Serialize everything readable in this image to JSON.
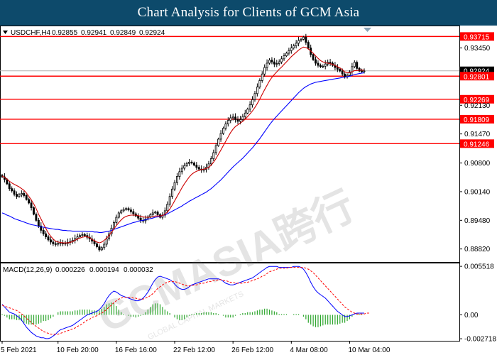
{
  "header": {
    "title": "Chart Analysis for Clients of GCM Asia"
  },
  "chart_data": {
    "type": "candlestick",
    "symbol_line": {
      "symbol": "USDCHF,H4",
      "ohlc": [
        "0.92855",
        "0.92941",
        "0.92849",
        "0.92924"
      ]
    },
    "watermark": {
      "text": "GCMASIA跨行",
      "subtext": "GLOBAL CAPITAL MARKETS"
    },
    "price_axis": {
      "range": [
        0.8852,
        0.9395
      ],
      "ticks": [
        "0.93450",
        "0.92130",
        "0.91470",
        "0.90800",
        "0.90140",
        "0.89480",
        "0.88820"
      ]
    },
    "current_price": {
      "label": "0.92924",
      "value": 0.92924,
      "color": "#000000"
    },
    "levels": [
      {
        "label": "0.93715",
        "value": 0.93715,
        "color": "#ff0000"
      },
      {
        "label": "0.92801",
        "value": 0.92801,
        "color": "#ff0000"
      },
      {
        "label": "0.92269",
        "value": 0.92269,
        "color": "#ff0000"
      },
      {
        "label": "0.91809",
        "value": 0.91809,
        "color": "#ff0000"
      },
      {
        "label": "0.91246",
        "value": 0.91246,
        "color": "#ff0000"
      }
    ],
    "x_labels": [
      "5 Feb 2021",
      "10 Feb 20:00",
      "16 Feb 16:00",
      "22 Feb 12:00",
      "26 Feb 12:00",
      "4 Mar 08:00",
      "10 Mar 04:00"
    ],
    "x_label_index": [
      0,
      23,
      47,
      71,
      95,
      119,
      143
    ],
    "close": [
      0.9048,
      0.9042,
      0.9032,
      0.9021,
      0.9016,
      0.9008,
      0.9003,
      0.9007,
      0.901,
      0.9005,
      0.8996,
      0.8988,
      0.8977,
      0.8962,
      0.8948,
      0.8935,
      0.8925,
      0.8917,
      0.891,
      0.8903,
      0.8898,
      0.8894,
      0.8893,
      0.8895,
      0.8896,
      0.8894,
      0.8895,
      0.8897,
      0.8899,
      0.8902,
      0.8906,
      0.891,
      0.8913,
      0.8915,
      0.8913,
      0.8909,
      0.8905,
      0.89,
      0.8894,
      0.8887,
      0.888,
      0.8885,
      0.8893,
      0.8905,
      0.8917,
      0.893,
      0.8943,
      0.8955,
      0.8965,
      0.897,
      0.8973,
      0.8975,
      0.8972,
      0.8968,
      0.8963,
      0.8958,
      0.8953,
      0.8948,
      0.8947,
      0.8951,
      0.8956,
      0.8961,
      0.8965,
      0.8967,
      0.8961,
      0.8955,
      0.896,
      0.897,
      0.8985,
      0.9003,
      0.902,
      0.9035,
      0.9049,
      0.906,
      0.9068,
      0.9074,
      0.9079,
      0.9082,
      0.908,
      0.9075,
      0.907,
      0.9066,
      0.9064,
      0.9065,
      0.907,
      0.9078,
      0.909,
      0.9104,
      0.912,
      0.9135,
      0.9148,
      0.916,
      0.917,
      0.9178,
      0.9184,
      0.9186,
      0.918,
      0.9176,
      0.918,
      0.9187,
      0.9195,
      0.9204,
      0.9214,
      0.9226,
      0.924,
      0.9255,
      0.927,
      0.9285,
      0.93,
      0.931,
      0.9317,
      0.9313,
      0.9308,
      0.9309,
      0.9313,
      0.932,
      0.9327,
      0.9333,
      0.9339,
      0.9345,
      0.935,
      0.9356,
      0.9362,
      0.9365,
      0.937,
      0.9358,
      0.9345,
      0.933,
      0.9318,
      0.931,
      0.9305,
      0.9302,
      0.9303,
      0.9308,
      0.9312,
      0.931,
      0.9305,
      0.93,
      0.9296,
      0.9292,
      0.9285,
      0.9278,
      0.9282,
      0.929,
      0.9302,
      0.9312,
      0.9298,
      0.9292,
      0.9291,
      0.9292
    ],
    "sma_short": [
      0.905,
      0.9047,
      0.9043,
      0.9038,
      0.9034,
      0.9031,
      0.9028,
      0.9025,
      0.9021,
      0.9017,
      0.9011,
      0.9003,
      0.8995,
      0.8986,
      0.8975,
      0.8962,
      0.8951,
      0.894,
      0.8929,
      0.8919,
      0.8911,
      0.8905,
      0.89,
      0.8898,
      0.8897,
      0.8896,
      0.8896,
      0.8896,
      0.8897,
      0.8899,
      0.8902,
      0.8905,
      0.8907,
      0.8909,
      0.891,
      0.891,
      0.8908,
      0.8904,
      0.8901,
      0.8898,
      0.8896,
      0.8898,
      0.8902,
      0.8907,
      0.8913,
      0.892,
      0.8928,
      0.8936,
      0.8943,
      0.8949,
      0.8954,
      0.8957,
      0.8959,
      0.896,
      0.896,
      0.896,
      0.8959,
      0.8957,
      0.8956,
      0.8955,
      0.8955,
      0.8955,
      0.8956,
      0.8958,
      0.8958,
      0.8958,
      0.8959,
      0.8962,
      0.8967,
      0.8974,
      0.8983,
      0.8993,
      0.9003,
      0.9013,
      0.9023,
      0.9032,
      0.904,
      0.9048,
      0.9054,
      0.9058,
      0.9061,
      0.9063,
      0.9065,
      0.9066,
      0.9067,
      0.907,
      0.9075,
      0.9082,
      0.909,
      0.91,
      0.911,
      0.912,
      0.913,
      0.914,
      0.915,
      0.9158,
      0.9164,
      0.9168,
      0.9172,
      0.9176,
      0.9181,
      0.9187,
      0.9193,
      0.92,
      0.9208,
      0.9217,
      0.9227,
      0.9238,
      0.9249,
      0.9259,
      0.9269,
      0.9277,
      0.9284,
      0.929,
      0.9296,
      0.9301,
      0.9307,
      0.9313,
      0.9319,
      0.9325,
      0.933,
      0.9335,
      0.934,
      0.9344,
      0.9347,
      0.9346,
      0.9343,
      0.9338,
      0.9333,
      0.9327,
      0.9321,
      0.9316,
      0.9313,
      0.9311,
      0.931,
      0.9309,
      0.9307,
      0.9305,
      0.9302,
      0.9299,
      0.9295,
      0.929,
      0.9288,
      0.9288,
      0.929,
      0.9293,
      0.9293,
      0.9294,
      0.9294,
      0.9294
    ],
    "sma_long": [
      0.8965,
      0.8963,
      0.896,
      0.8958,
      0.8955,
      0.8952,
      0.895,
      0.8948,
      0.8946,
      0.8944,
      0.8942,
      0.894,
      0.8938,
      0.8937,
      0.8936,
      0.8934,
      0.8933,
      0.8932,
      0.8931,
      0.893,
      0.8929,
      0.8928,
      0.8927,
      0.8927,
      0.8926,
      0.8925,
      0.8925,
      0.8924,
      0.8924,
      0.8923,
      0.8923,
      0.8923,
      0.8923,
      0.8923,
      0.8923,
      0.8922,
      0.8922,
      0.8922,
      0.8921,
      0.8921,
      0.892,
      0.892,
      0.8921,
      0.8922,
      0.8923,
      0.8925,
      0.8927,
      0.8929,
      0.8931,
      0.8933,
      0.8935,
      0.8937,
      0.8939,
      0.8941,
      0.8943,
      0.8944,
      0.8946,
      0.8947,
      0.8948,
      0.8949,
      0.8951,
      0.8952,
      0.8953,
      0.8955,
      0.8956,
      0.8957,
      0.8959,
      0.8961,
      0.8963,
      0.8966,
      0.8969,
      0.8972,
      0.8975,
      0.8978,
      0.8981,
      0.8985,
      0.8988,
      0.8992,
      0.8995,
      0.8998,
      0.9001,
      0.9004,
      0.9007,
      0.901,
      0.9013,
      0.9017,
      0.9021,
      0.9026,
      0.9031,
      0.9036,
      0.9041,
      0.9047,
      0.9053,
      0.9059,
      0.9065,
      0.9071,
      0.9076,
      0.9081,
      0.9086,
      0.9091,
      0.9097,
      0.9103,
      0.9109,
      0.9115,
      0.9122,
      0.9129,
      0.9136,
      0.9144,
      0.9152,
      0.916,
      0.9168,
      0.9175,
      0.9182,
      0.9188,
      0.9194,
      0.92,
      0.9206,
      0.9212,
      0.9218,
      0.9224,
      0.923,
      0.9236,
      0.9242,
      0.9247,
      0.9252,
      0.9256,
      0.9259,
      0.9262,
      0.9264,
      0.9266,
      0.9267,
      0.9268,
      0.9269,
      0.927,
      0.9271,
      0.9272,
      0.9273,
      0.9274,
      0.9275,
      0.9276,
      0.9277,
      0.9278,
      0.9279,
      0.928,
      0.9282,
      0.9284,
      0.9285,
      0.9286,
      0.9287,
      0.9288
    ],
    "macd": {
      "label": "MACD(12,26,9)",
      "values_text": [
        "0.000226",
        "0.000194",
        "0.000032"
      ],
      "range": [
        -0.00295,
        0.00585
      ],
      "ticks": [
        "0.005518",
        "0.00",
        "-0.002718"
      ],
      "macd_line": [
        0.0012,
        0.0009,
        0.0006,
        0.0003,
        0.0002,
        0.0001,
        -0.0001,
        -0.0003,
        -0.0006,
        -0.001,
        -0.0014,
        -0.0017,
        -0.002,
        -0.0022,
        -0.0024,
        -0.0025,
        -0.0026,
        -0.0026,
        -0.0027,
        -0.0027,
        -0.0026,
        -0.0024,
        -0.0022,
        -0.0019,
        -0.0017,
        -0.0016,
        -0.0015,
        -0.0014,
        -0.0013,
        -0.0012,
        -0.001,
        -0.0008,
        -0.0006,
        -0.0004,
        -0.0002,
        0.0,
        0.0001,
        0.0002,
        0.0003,
        0.0004,
        0.0006,
        0.0009,
        0.0013,
        0.0018,
        0.0022,
        0.0025,
        0.0027,
        0.0026,
        0.0024,
        0.0022,
        0.0021,
        0.002,
        0.0019,
        0.0018,
        0.0017,
        0.0016,
        0.0016,
        0.0017,
        0.0019,
        0.0022,
        0.0026,
        0.0031,
        0.0036,
        0.004,
        0.0043,
        0.0044,
        0.0043,
        0.0042,
        0.0041,
        0.004,
        0.0038,
        0.0035,
        0.0032,
        0.003,
        0.0029,
        0.0029,
        0.003,
        0.0032,
        0.0034,
        0.0035,
        0.0036,
        0.0037,
        0.0038,
        0.0039,
        0.004,
        0.0041,
        0.0041,
        0.0041,
        0.0041,
        0.0041,
        0.004,
        0.0038,
        0.0036,
        0.0035,
        0.0034,
        0.0034,
        0.0035,
        0.0036,
        0.0037,
        0.0038,
        0.0039,
        0.004,
        0.0041,
        0.0042,
        0.0044,
        0.0046,
        0.0048,
        0.005,
        0.0052,
        0.0054,
        0.0055,
        0.0055,
        0.0055,
        0.0055,
        0.0054,
        0.0054,
        0.0054,
        0.0054,
        0.0054,
        0.0054,
        0.0055,
        0.0055,
        0.0055,
        0.0054,
        0.0052,
        0.0048,
        0.0043,
        0.0037,
        0.0032,
        0.0028,
        0.0025,
        0.0023,
        0.0021,
        0.0019,
        0.0016,
        0.0013,
        0.001,
        0.0007,
        0.0004,
        0.0002,
        0.0,
        -0.0002,
        -0.0002,
        -0.0001,
        0.0,
        0.0001,
        0.0002,
        0.0002,
        0.0002,
        0.0002
      ],
      "signal_line": [
        0.0011,
        0.001,
        0.0009,
        0.0008,
        0.0007,
        0.0006,
        0.0005,
        0.0003,
        0.0001,
        -0.0001,
        -0.0004,
        -0.0006,
        -0.0009,
        -0.0011,
        -0.0013,
        -0.0015,
        -0.0017,
        -0.0019,
        -0.002,
        -0.0021,
        -0.0022,
        -0.0022,
        -0.0022,
        -0.0022,
        -0.0021,
        -0.002,
        -0.0019,
        -0.0018,
        -0.0017,
        -0.0016,
        -0.0015,
        -0.0013,
        -0.0012,
        -0.001,
        -0.0008,
        -0.0006,
        -0.0005,
        -0.0003,
        -0.0002,
        -0.0001,
        0.0001,
        0.0002,
        0.0004,
        0.0006,
        0.0009,
        0.0011,
        0.0014,
        0.0016,
        0.0018,
        0.0019,
        0.002,
        0.002,
        0.002,
        0.002,
        0.0019,
        0.0019,
        0.0018,
        0.0018,
        0.0018,
        0.0019,
        0.002,
        0.0022,
        0.0024,
        0.0027,
        0.003,
        0.0032,
        0.0034,
        0.0036,
        0.0037,
        0.0038,
        0.0038,
        0.0038,
        0.0037,
        0.0036,
        0.0035,
        0.0034,
        0.0033,
        0.0033,
        0.0033,
        0.0034,
        0.0034,
        0.0035,
        0.0036,
        0.0036,
        0.0037,
        0.0038,
        0.0038,
        0.0039,
        0.0039,
        0.004,
        0.004,
        0.0039,
        0.0039,
        0.0038,
        0.0037,
        0.0037,
        0.0036,
        0.0036,
        0.0036,
        0.0036,
        0.0037,
        0.0037,
        0.0038,
        0.0039,
        0.004,
        0.0041,
        0.0042,
        0.0044,
        0.0045,
        0.0047,
        0.0049,
        0.005,
        0.0051,
        0.0052,
        0.0053,
        0.0053,
        0.0053,
        0.0053,
        0.0054,
        0.0054,
        0.0054,
        0.0054,
        0.0054,
        0.0054,
        0.0054,
        0.0053,
        0.0052,
        0.005,
        0.0048,
        0.0045,
        0.0042,
        0.0039,
        0.0036,
        0.0033,
        0.003,
        0.0027,
        0.0024,
        0.0021,
        0.0018,
        0.0015,
        0.0012,
        0.0009,
        0.0007,
        0.0005,
        0.0003,
        0.0002,
        0.0001,
        0.0001,
        0.0001,
        0.0001,
        0.0002,
        0.0002
      ],
      "histogram": [
        0.0001,
        -0.0001,
        -0.0003,
        -0.0005,
        -0.0005,
        -0.0005,
        -0.0006,
        -0.0006,
        -0.0007,
        -0.0009,
        -0.001,
        -0.0011,
        -0.0011,
        -0.0011,
        -0.0011,
        -0.001,
        -0.0009,
        -0.0007,
        -0.0007,
        -0.0006,
        -0.0004,
        -0.0002,
        0.0,
        0.0003,
        0.0004,
        0.0004,
        0.0004,
        0.0004,
        0.0004,
        0.0004,
        0.0005,
        0.0005,
        0.0006,
        0.0006,
        0.0006,
        0.0006,
        0.0006,
        0.0005,
        0.0005,
        0.0005,
        0.0005,
        0.0007,
        0.0009,
        0.0012,
        0.0013,
        0.0014,
        0.0013,
        0.001,
        0.0006,
        0.0003,
        0.0001,
        0.0,
        -0.0001,
        -0.0002,
        -0.0002,
        -0.0003,
        -0.0002,
        -0.0001,
        0.0001,
        0.0003,
        0.0006,
        0.0009,
        0.0012,
        0.0013,
        0.0013,
        0.0012,
        0.0009,
        0.0006,
        0.0004,
        0.0002,
        0.0,
        -0.0003,
        -0.0005,
        -0.0006,
        -0.0006,
        -0.0005,
        -0.0003,
        -0.0001,
        0.0001,
        0.0001,
        0.0002,
        0.0002,
        0.0002,
        0.0003,
        0.0003,
        0.0003,
        0.0003,
        0.0002,
        0.0002,
        0.0001,
        0.0,
        -0.0001,
        -0.0003,
        -0.0003,
        -0.0003,
        -0.0003,
        -0.0001,
        0.0,
        0.0001,
        0.0002,
        0.0002,
        0.0003,
        0.0003,
        0.0003,
        0.0004,
        0.0005,
        0.0006,
        0.0006,
        0.0007,
        0.0007,
        0.0006,
        0.0005,
        0.0004,
        0.0003,
        0.0001,
        0.0001,
        0.0001,
        0.0001,
        0.0,
        0.0,
        0.0001,
        0.0001,
        0.0001,
        0.0,
        -0.0002,
        -0.0005,
        -0.0009,
        -0.0011,
        -0.0013,
        -0.0014,
        -0.0014,
        -0.0013,
        -0.0012,
        -0.0011,
        -0.0011,
        -0.0011,
        -0.0011,
        -0.0011,
        -0.0011,
        -0.001,
        -0.0009,
        -0.0009,
        -0.0007,
        -0.0005,
        -0.0002,
        0.0,
        0.0001,
        0.0001,
        0.0001,
        0.0
      ],
      "colors": {
        "macd": "#0000ff",
        "signal": "#ff0000",
        "histogram": "#2ea62e"
      }
    },
    "colors": {
      "up": "#000000",
      "down": "#000000",
      "sma_short": "#cc0000",
      "sma_long": "#0000ff",
      "level_line": "#ff0000"
    }
  }
}
